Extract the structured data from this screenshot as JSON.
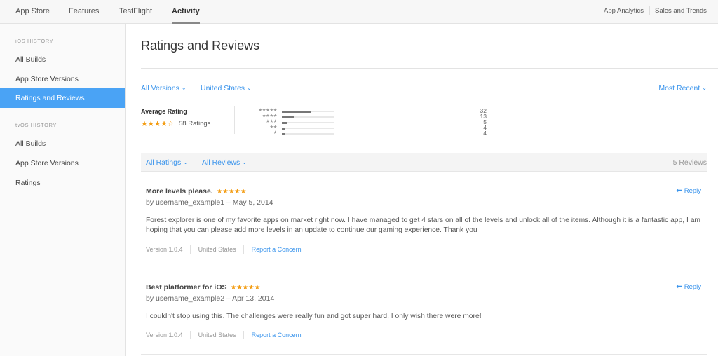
{
  "topnav": {
    "tabs": [
      {
        "label": "App Store"
      },
      {
        "label": "Features"
      },
      {
        "label": "TestFlight"
      },
      {
        "label": "Activity",
        "active": true
      }
    ],
    "right_links": [
      {
        "label": "App Analytics"
      },
      {
        "label": "Sales and Trends"
      }
    ]
  },
  "sidebar": {
    "ios_section": "iOS HISTORY",
    "ios_items": [
      {
        "label": "All Builds"
      },
      {
        "label": "App Store Versions"
      },
      {
        "label": "Ratings and Reviews",
        "active": true
      }
    ],
    "tvos_section": "tvOS HISTORY",
    "tvos_items": [
      {
        "label": "All Builds"
      },
      {
        "label": "App Store Versions"
      },
      {
        "label": "Ratings"
      }
    ]
  },
  "main": {
    "title": "Ratings and Reviews",
    "filters": {
      "version": "All Versions",
      "country": "United States",
      "sort": "Most Recent",
      "chevron": "⌄"
    },
    "summary": {
      "average_label": "Average Rating",
      "average_stars": "★★★★☆",
      "average_value": 4,
      "ratings_count": "58 Ratings",
      "histogram": [
        {
          "stars": "★★★★★",
          "count": 32,
          "fraction": 0.55
        },
        {
          "stars": "★★★★",
          "count": 13,
          "fraction": 0.22
        },
        {
          "stars": "★★★",
          "count": 5,
          "fraction": 0.09
        },
        {
          "stars": "★★",
          "count": 4,
          "fraction": 0.07
        },
        {
          "stars": "★",
          "count": 4,
          "fraction": 0.07
        }
      ]
    },
    "review_filters": {
      "ratings": "All Ratings",
      "reviews": "All Reviews",
      "count": "5 Reviews"
    },
    "reviews": [
      {
        "title": "More levels please.",
        "stars": "★★★★★",
        "byline": "by username_example1 – May 5, 2014",
        "body": "Forest explorer is one of my favorite apps on market right now. I have managed to get 4 stars on all of the levels and unlock all of the items. Although it is a fantastic app, I am hoping that you can please add more levels in an update to continue our gaming experience. Thank you",
        "version": "Version 1.0.4",
        "country": "United States",
        "report": "Report a Concern",
        "reply": "Reply"
      },
      {
        "title": "Best platformer for iOS",
        "stars": "★★★★★",
        "byline": "by username_example2 – Apr 13, 2014",
        "body": "I couldn't stop using this. The challenges were really fun and got super hard, I only wish there were more!",
        "version": "Version 1.0.4",
        "country": "United States",
        "report": "Report a Concern",
        "reply": "Reply"
      }
    ]
  },
  "colors": {
    "accent": "#3a94ec",
    "sidebar_active": "#4aa3f5",
    "star": "#f39c12"
  }
}
